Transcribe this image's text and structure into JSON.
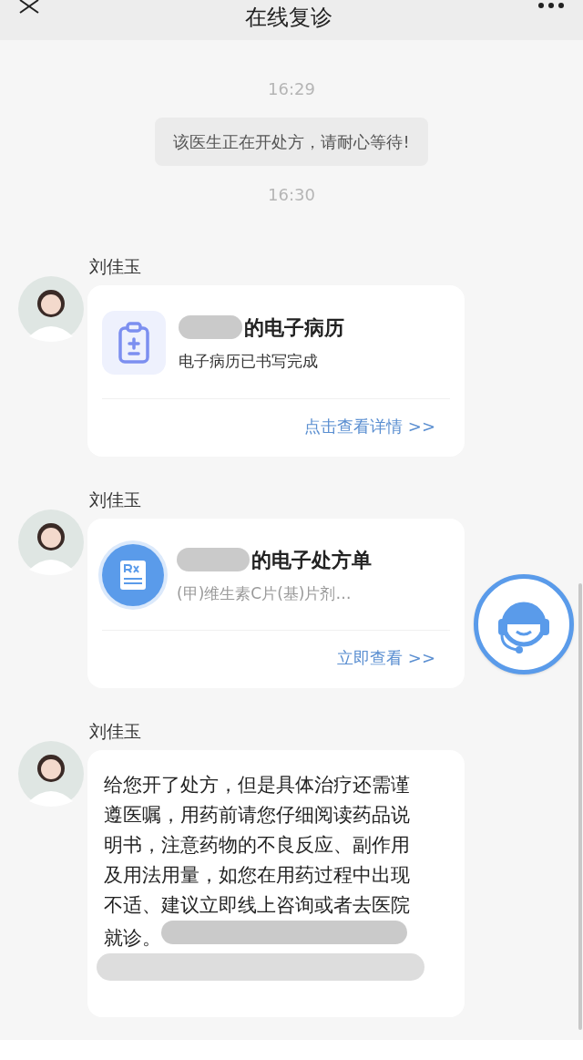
{
  "header": {
    "title": "在线复诊"
  },
  "messages": [
    {
      "kind": "time",
      "text": "16:29"
    },
    {
      "kind": "notice",
      "text": "该医生正在开处方，请耐心等待!"
    },
    {
      "kind": "time",
      "text": "16:30"
    },
    {
      "kind": "record",
      "sender": "刘佳玉",
      "title": "的电子病历",
      "subtitle": "电子病历已书写完成",
      "link": "点击查看详情 >>"
    },
    {
      "kind": "prescription",
      "sender": "刘佳玉",
      "title": "的电子处方单",
      "subtitle": "(甲)维生素C片(基)片剂…",
      "link": "立即查看 >>"
    },
    {
      "kind": "text",
      "sender": "刘佳玉",
      "lines": [
        "给您开了处方，但是具体治疗还需谨",
        "遵医嘱，用药前请您仔细阅读药品说",
        "明书，注意药物的不良反应、副作用",
        "及用法用量，如您在用药过程中出现",
        "不适、建议立即线上咨询或者去医院",
        "就诊。"
      ]
    }
  ]
}
